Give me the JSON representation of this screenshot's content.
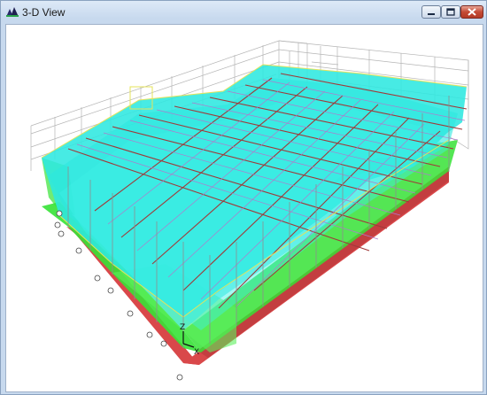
{
  "window": {
    "title": "3-D View",
    "controls": {
      "minimize": "minimize",
      "maximize": "maximize",
      "close": "close"
    }
  },
  "viewport": {
    "axis_labels": {
      "x": "X",
      "z": "Z"
    },
    "colors": {
      "slab": "#2de8e0",
      "wall_green": "#36e236",
      "base_red": "#d9484a",
      "frame_grey": "#9a9a9a",
      "beam_red": "#a03a3a",
      "joist_purple": "#b07acb",
      "edge_yellow": "#e6e35a"
    }
  }
}
